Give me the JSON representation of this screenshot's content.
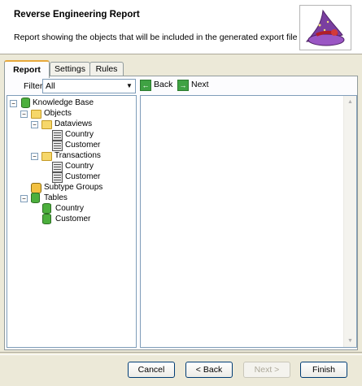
{
  "header": {
    "title": "Reverse Engineering Report",
    "description": "Report showing the objects that will be included in the generated export file",
    "image_icon": "wizard-hat-icon"
  },
  "tabs": [
    {
      "label": "Report",
      "active": true
    },
    {
      "label": "Settings",
      "active": false
    },
    {
      "label": "Rules",
      "active": false
    }
  ],
  "filter": {
    "label": "Filter",
    "value": "All"
  },
  "tree": {
    "root": "Knowledge Base",
    "objects": "Objects",
    "dataviews": "Dataviews",
    "dataviews_items": [
      "Country",
      "Customer"
    ],
    "transactions": "Transactions",
    "transactions_items": [
      "Country",
      "Customer"
    ],
    "subtype_groups": "Subtype Groups",
    "tables": "Tables",
    "tables_items": [
      "Country",
      "Customer"
    ]
  },
  "nav": {
    "back": "Back",
    "next": "Next"
  },
  "buttons": {
    "cancel": "Cancel",
    "back": "< Back",
    "next": "Next >",
    "finish": "Finish"
  },
  "colors": {
    "accent_tab": "#e7a93c",
    "dialog_bg": "#ece9d8",
    "border": "#7f9db9",
    "arrow_green": "#3fa243"
  }
}
